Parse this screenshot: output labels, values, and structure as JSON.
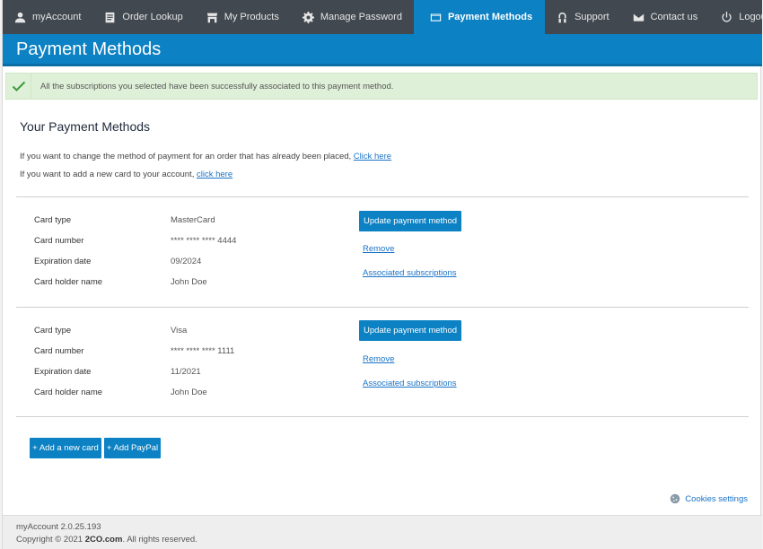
{
  "nav": {
    "items": [
      {
        "label": "myAccount",
        "icon": "user-icon"
      },
      {
        "label": "Order Lookup",
        "icon": "document-icon"
      },
      {
        "label": "My Products",
        "icon": "store-icon"
      },
      {
        "label": "Manage Password",
        "icon": "gear-icon"
      },
      {
        "label": "Payment Methods",
        "icon": "credit-card-icon",
        "active": true
      },
      {
        "label": "Support",
        "icon": "support-icon"
      }
    ],
    "right": [
      {
        "label": "Contact us",
        "icon": "envelope-icon"
      },
      {
        "label": "Logout",
        "icon": "power-icon"
      }
    ]
  },
  "page": {
    "title": "Payment Methods"
  },
  "alert": {
    "message": "All the subscriptions you selected have been successfully associated to this payment method."
  },
  "content": {
    "section_title": "Your Payment Methods",
    "change_text": "If you want to change the method of payment for an order that has already been placed, ",
    "change_link": "Click here",
    "add_text": "If you want to add a new card to your account, ",
    "add_link": "click here"
  },
  "labels": {
    "card_type": "Card type",
    "card_number": "Card number",
    "expiration": "Expiration date",
    "holder": "Card holder name",
    "update": "Update payment method",
    "remove": "Remove",
    "associated": "Associated subscriptions"
  },
  "cards": [
    {
      "type": "MasterCard",
      "number": "**** **** **** 4444",
      "expiration": "09/2024",
      "holder": "John Doe"
    },
    {
      "type": "Visa",
      "number": "**** **** **** 1111",
      "expiration": "11/2021",
      "holder": "John Doe"
    }
  ],
  "actions": {
    "add_card": "+ Add a new card",
    "add_paypal": "+ Add PayPal"
  },
  "cookies": "Cookies settings",
  "footer": {
    "version": "myAccount 2.0.25.193",
    "copy_prefix": "Copyright © 2021 ",
    "copy_brand": "2CO.com",
    "copy_suffix": ". All rights reserved."
  },
  "colors": {
    "nav_bg": "#414850",
    "accent": "#0c81c3",
    "alert_bg": "#dff0d8",
    "check": "#3c9a3c",
    "link": "#1a73c8"
  }
}
